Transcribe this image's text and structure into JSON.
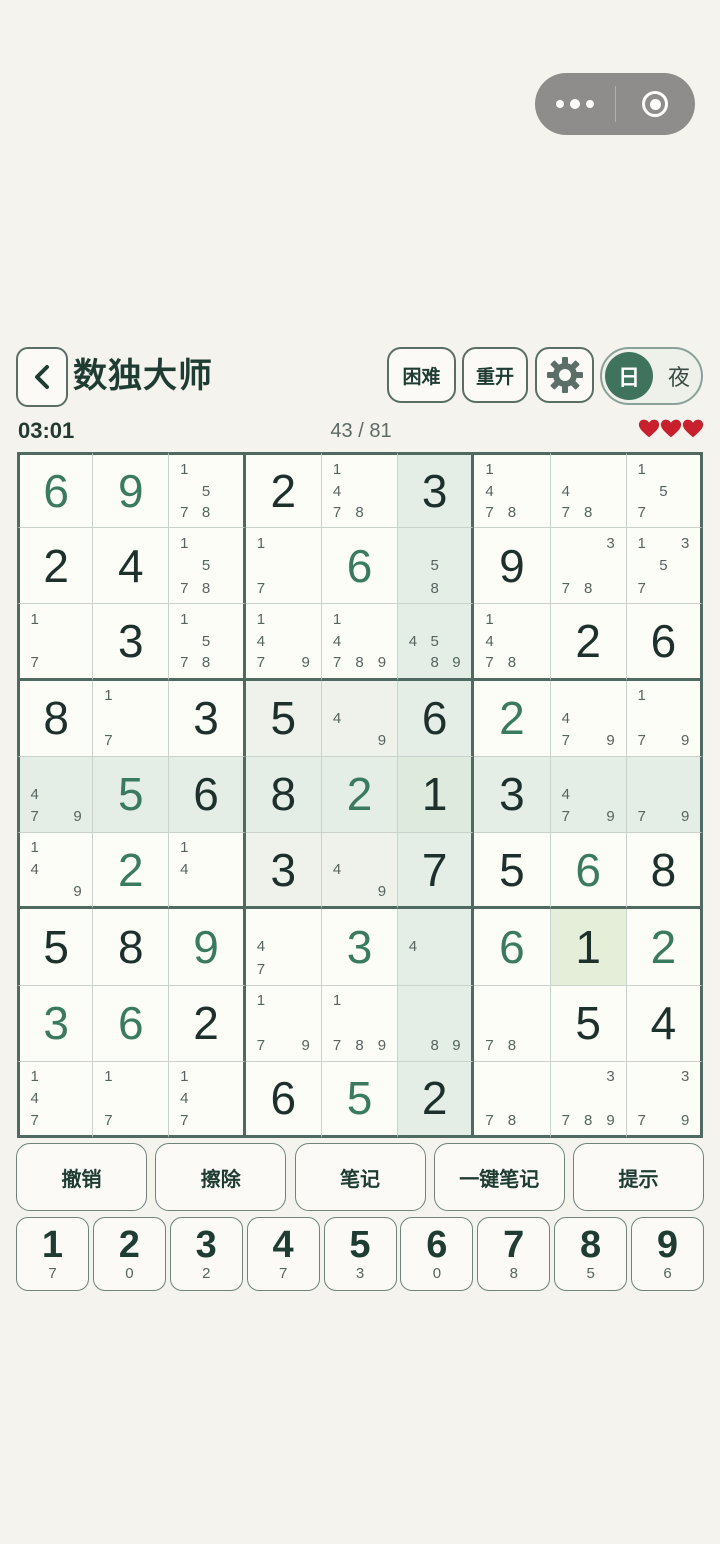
{
  "header": {
    "title": "数独大师",
    "difficulty_label": "困难",
    "restart_label": "重开",
    "day_label": "日",
    "night_label": "夜"
  },
  "status": {
    "timer": "03:01",
    "progress": "43 / 81",
    "lives": 3
  },
  "board": {
    "selected": [
      6,
      7
    ],
    "cells": [
      [
        {
          "v": 6,
          "u": true
        },
        {
          "v": 9,
          "u": true
        },
        {
          "n": [
            1,
            5,
            7,
            8
          ]
        },
        {
          "v": 2
        },
        {
          "n": [
            1,
            4,
            7,
            8
          ]
        },
        {
          "v": 3
        },
        {
          "n": [
            1,
            4,
            7,
            8
          ]
        },
        {
          "n": [
            4,
            7,
            8
          ]
        },
        {
          "n": [
            1,
            5,
            7
          ]
        }
      ],
      [
        {
          "v": 2
        },
        {
          "v": 4
        },
        {
          "n": [
            1,
            5,
            7,
            8
          ]
        },
        {
          "n": [
            1,
            7
          ]
        },
        {
          "v": 6,
          "u": true
        },
        {
          "n": [
            5,
            8
          ]
        },
        {
          "v": 9
        },
        {
          "n": [
            3,
            7,
            8
          ]
        },
        {
          "n": [
            1,
            3,
            5,
            7
          ]
        }
      ],
      [
        {
          "n": [
            1,
            7
          ]
        },
        {
          "v": 3
        },
        {
          "n": [
            1,
            5,
            7,
            8
          ]
        },
        {
          "n": [
            1,
            4,
            7,
            9
          ]
        },
        {
          "n": [
            1,
            4,
            7,
            8,
            9
          ]
        },
        {
          "n": [
            4,
            5,
            8,
            9
          ]
        },
        {
          "n": [
            1,
            4,
            7,
            8
          ]
        },
        {
          "v": 2
        },
        {
          "v": 6
        }
      ],
      [
        {
          "v": 8
        },
        {
          "n": [
            1,
            7
          ]
        },
        {
          "v": 3
        },
        {
          "v": 5
        },
        {
          "n": [
            4,
            9
          ]
        },
        {
          "v": 6
        },
        {
          "v": 2,
          "u": true
        },
        {
          "n": [
            4,
            7,
            9
          ]
        },
        {
          "n": [
            1,
            7,
            9
          ]
        }
      ],
      [
        {
          "n": [
            4,
            7,
            9
          ]
        },
        {
          "v": 5,
          "u": true
        },
        {
          "v": 6
        },
        {
          "v": 8
        },
        {
          "v": 2,
          "u": true
        },
        {
          "v": 1
        },
        {
          "v": 3
        },
        {
          "n": [
            4,
            7,
            9
          ]
        },
        {
          "n": [
            7,
            9
          ]
        }
      ],
      [
        {
          "n": [
            1,
            4,
            9
          ]
        },
        {
          "v": 2,
          "u": true
        },
        {
          "n": [
            1,
            4
          ]
        },
        {
          "v": 3
        },
        {
          "n": [
            4,
            9
          ]
        },
        {
          "v": 7
        },
        {
          "v": 5
        },
        {
          "v": 6,
          "u": true
        },
        {
          "v": 8
        }
      ],
      [
        {
          "v": 5
        },
        {
          "v": 8
        },
        {
          "v": 9,
          "u": true
        },
        {
          "n": [
            4,
            7
          ]
        },
        {
          "v": 3,
          "u": true
        },
        {
          "n": [
            4
          ]
        },
        {
          "v": 6,
          "u": true
        },
        {
          "v": 1
        },
        {
          "v": 2,
          "u": true
        }
      ],
      [
        {
          "v": 3,
          "u": true
        },
        {
          "v": 6,
          "u": true
        },
        {
          "v": 2
        },
        {
          "n": [
            1,
            7,
            9
          ]
        },
        {
          "n": [
            1,
            7,
            8,
            9
          ]
        },
        {
          "n": [
            8,
            9
          ]
        },
        {
          "n": [
            7,
            8
          ]
        },
        {
          "v": 5
        },
        {
          "v": 4
        }
      ],
      [
        {
          "n": [
            1,
            4,
            7
          ]
        },
        {
          "n": [
            1,
            7
          ]
        },
        {
          "n": [
            1,
            4,
            7
          ]
        },
        {
          "v": 6
        },
        {
          "v": 5,
          "u": true
        },
        {
          "v": 2
        },
        {
          "n": [
            7,
            8
          ]
        },
        {
          "n": [
            3,
            7,
            8,
            9
          ]
        },
        {
          "n": [
            3,
            7,
            9
          ]
        }
      ]
    ]
  },
  "actions": [
    "撤销",
    "擦除",
    "笔记",
    "一键笔记",
    "提示"
  ],
  "numpad": [
    {
      "digit": "1",
      "count": "7"
    },
    {
      "digit": "2",
      "count": "0"
    },
    {
      "digit": "3",
      "count": "2"
    },
    {
      "digit": "4",
      "count": "7"
    },
    {
      "digit": "5",
      "count": "3"
    },
    {
      "digit": "6",
      "count": "0"
    },
    {
      "digit": "7",
      "count": "8"
    },
    {
      "digit": "8",
      "count": "5"
    },
    {
      "digit": "9",
      "count": "6"
    }
  ],
  "colors": {
    "accent": "#3f735e",
    "heart": "#c8202c",
    "given_digit": "#1d302b",
    "user_digit": "#3a7a5e"
  }
}
